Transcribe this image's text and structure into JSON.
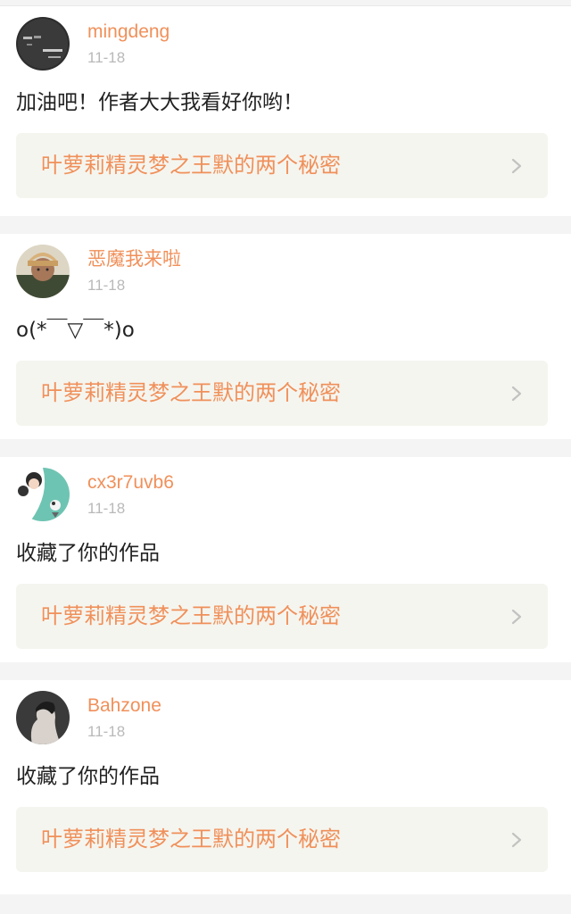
{
  "feed": [
    {
      "username": "mingdeng",
      "date": "11-18",
      "comment": "加油吧！作者大大我看好你哟！",
      "work_title": "叶萝莉精灵梦之王默的两个秘密",
      "avatar": "avatar-dark-text-icon"
    },
    {
      "username": "恶魔我来啦",
      "date": "11-18",
      "comment": "o(*￣▽￣*)o",
      "work_title": "叶萝莉精灵梦之王默的两个秘密",
      "avatar": "avatar-person-cap-icon"
    },
    {
      "username": "cx3r7uvb6",
      "date": "11-18",
      "comment": "收藏了你的作品",
      "work_title": "叶萝莉精灵梦之王默的两个秘密",
      "avatar": "avatar-teal-illustration-icon"
    },
    {
      "username": "Bahzone",
      "date": "11-18",
      "comment": "收藏了你的作品",
      "work_title": "叶萝莉精灵梦之王默的两个秘密",
      "avatar": "avatar-profile-silhouette-icon"
    }
  ],
  "colors": {
    "accent": "#f0905a",
    "date": "#b9b9b9",
    "card_bg": "#f5f5ef",
    "page_bg": "#f4f4f4"
  },
  "icons": {
    "chevron": "chevron-right-icon"
  }
}
